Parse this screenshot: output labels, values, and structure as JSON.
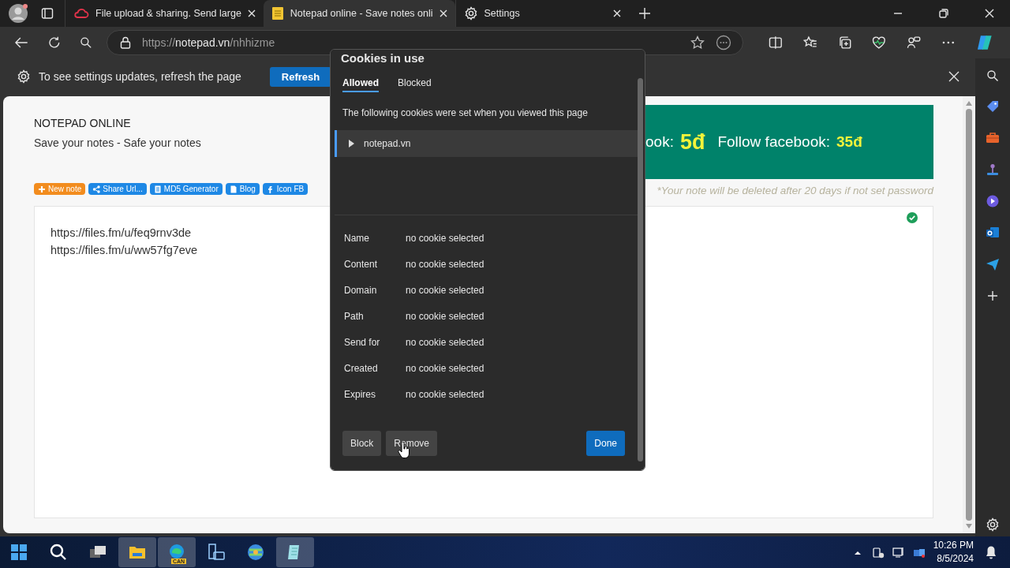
{
  "browser": {
    "tabs": [
      {
        "kind": "cloud",
        "title": "File upload & sharing. Send large",
        "selected": false
      },
      {
        "kind": "notepad",
        "title": "Notepad online - Save notes onli",
        "selected": true
      },
      {
        "kind": "gear",
        "title": "Settings",
        "selected": false
      }
    ],
    "address": {
      "scheme": "https://",
      "host": "notepad.vn",
      "path": "/nhhizme"
    },
    "infobar": {
      "message": "To see settings updates, refresh the page",
      "button": "Refresh"
    }
  },
  "page": {
    "title": "NOTEPAD ONLINE",
    "tagline": "Save your notes - Safe your notes",
    "links": [
      {
        "kind": "plus",
        "label": "New note",
        "color": "#f28c1e"
      },
      {
        "kind": "share",
        "label": "Share Url...",
        "color": "#1e88e5"
      },
      {
        "kind": "doc",
        "label": "MD5 Generator",
        "color": "#1e88e5"
      },
      {
        "kind": "file",
        "label": "Blog",
        "color": "#1e88e5"
      },
      {
        "kind": "facebook",
        "label": "Icon FB",
        "color": "#1e88e5"
      }
    ],
    "banner": [
      {
        "label": "ook:",
        "price": "5đ"
      },
      {
        "label": "Follow facebook:",
        "price": "35đ"
      }
    ],
    "notice": "*Your note will be deleted after 20 days if not set password",
    "saved": true,
    "note_lines": [
      "https://files.fm/u/feq9rnv3de",
      "https://files.fm/u/ww57fg7eve"
    ]
  },
  "cookies_dialog": {
    "title": "Cookies in use",
    "tabs": [
      {
        "label": "Allowed",
        "selected": true
      },
      {
        "label": "Blocked",
        "selected": false
      }
    ],
    "description": "The following cookies were set when you viewed this page",
    "sites": [
      {
        "label": "notepad.vn",
        "selected": true,
        "expanded": false
      }
    ],
    "details": [
      {
        "label": "Name",
        "value": "no cookie selected"
      },
      {
        "label": "Content",
        "value": "no cookie selected"
      },
      {
        "label": "Domain",
        "value": "no cookie selected"
      },
      {
        "label": "Path",
        "value": "no cookie selected"
      },
      {
        "label": "Send for",
        "value": "no cookie selected"
      },
      {
        "label": "Created",
        "value": "no cookie selected"
      },
      {
        "label": "Expires",
        "value": "no cookie selected"
      }
    ],
    "buttons": [
      {
        "label": "Block",
        "kind": "secondary"
      },
      {
        "label": "Remove",
        "kind": "secondary"
      },
      {
        "label": "Done",
        "kind": "primary"
      }
    ]
  },
  "taskbar": {
    "apps": [
      {
        "kind": "start",
        "selected": false
      },
      {
        "kind": "search",
        "selected": false
      },
      {
        "kind": "taskview",
        "selected": false
      },
      {
        "kind": "explorer",
        "selected": true
      },
      {
        "kind": "edge",
        "selected": true,
        "badge": "CAN"
      },
      {
        "kind": "files",
        "selected": false
      },
      {
        "kind": "globe",
        "selected": false
      },
      {
        "kind": "notepad",
        "selected": true
      }
    ],
    "time": "10:26 PM",
    "date": "8/5/2024"
  }
}
